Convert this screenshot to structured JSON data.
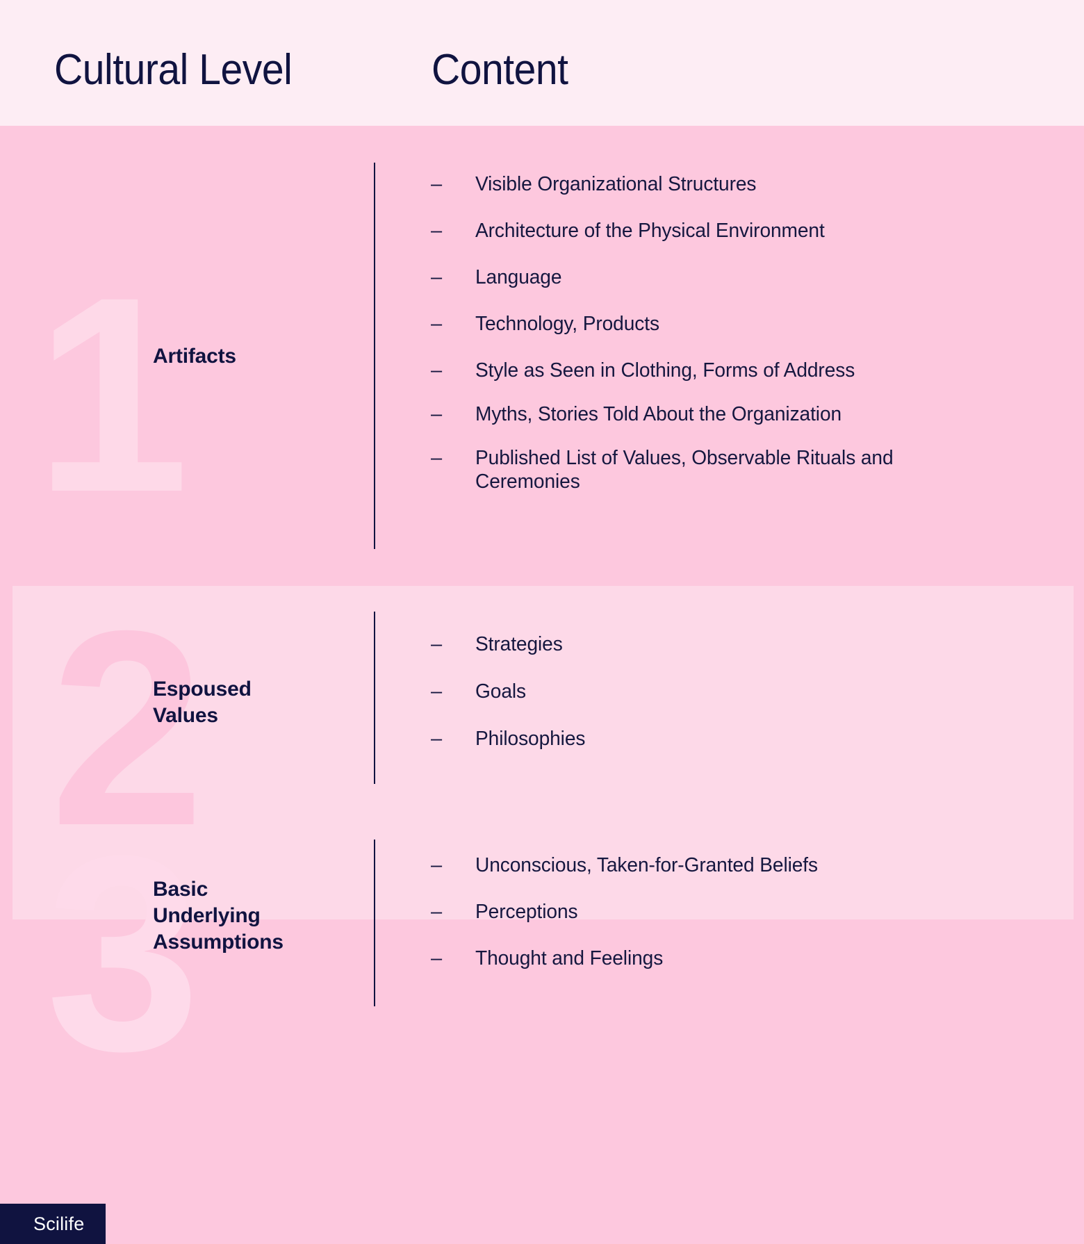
{
  "header": {
    "column_cultural_level": "Cultural Level",
    "column_content": "Content"
  },
  "theme": {
    "page_background": "#fce9f1",
    "header_background": "#fdedf4",
    "band_dark_pink": "#fdc8de",
    "band_light_pink": "#fdd9e8",
    "text_navy": "#101340",
    "watermark_1": "#fed9e8",
    "watermark_2": "#fdc6dd",
    "watermark_3": "#fedaea",
    "logo_background": "#101340",
    "logo_text": "#ffffff"
  },
  "bullet": "–",
  "sections": [
    {
      "number": "1",
      "label": "Artifacts",
      "items": [
        "Visible Organizational Structures",
        "Architecture of the Physical Environment",
        "Language",
        "Technology, Products",
        "Style as Seen in Clothing, Forms of Address",
        "Myths, Stories Told About the Organization",
        "Published List of Values, Observable Rituals and Ceremonies"
      ]
    },
    {
      "number": "2",
      "label": "Espoused Values",
      "items": [
        "Strategies",
        "Goals",
        "Philosophies"
      ]
    },
    {
      "number": "3",
      "label": "Basic Underlying Assumptions",
      "items": [
        "Unconscious, Taken-for-Granted Beliefs",
        "Perceptions",
        "Thought and Feelings"
      ]
    }
  ],
  "footer": {
    "brand": "Scilife"
  }
}
